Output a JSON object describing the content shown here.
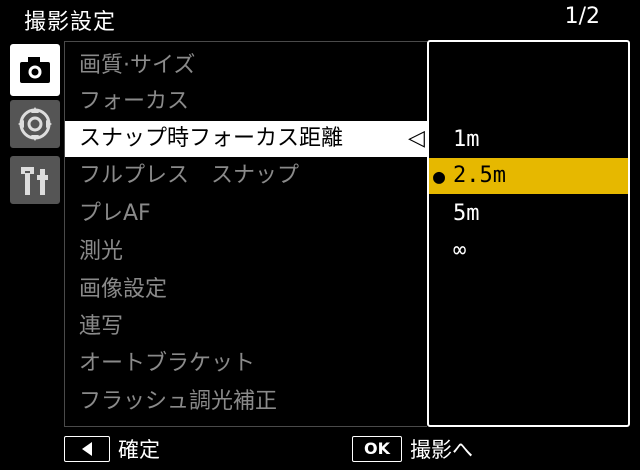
{
  "header": {
    "title": "撮影設定",
    "page_indicator": "1/2"
  },
  "tabs": [
    {
      "name": "camera",
      "icon": "camera-icon",
      "active": true
    },
    {
      "name": "setup",
      "icon": "dial-icon",
      "active": false
    },
    {
      "name": "tools",
      "icon": "tools-icon",
      "active": false
    }
  ],
  "menu": {
    "items": [
      {
        "label": "画質·サイズ"
      },
      {
        "label": "フォーカス"
      },
      {
        "label": "スナップ時フォーカス距離",
        "active": true
      },
      {
        "label": "フルプレス　スナップ"
      },
      {
        "label": "プレAF"
      },
      {
        "label": "測光"
      },
      {
        "label": "画像設定"
      },
      {
        "label": "連写"
      },
      {
        "label": "オートブラケット"
      },
      {
        "label": "フラッシュ調光補正"
      }
    ],
    "active_arrow": "◁"
  },
  "dropdown": {
    "options": [
      "1m",
      "2.5m",
      "5m",
      "∞"
    ],
    "selected_index": 1,
    "selected_color": "#e6b800",
    "selected_marker": "●"
  },
  "footer": {
    "left_key_icon": "left-arrow-icon",
    "confirm_label": "確定",
    "ok_key": "OK",
    "shoot_label": "撮影へ"
  }
}
